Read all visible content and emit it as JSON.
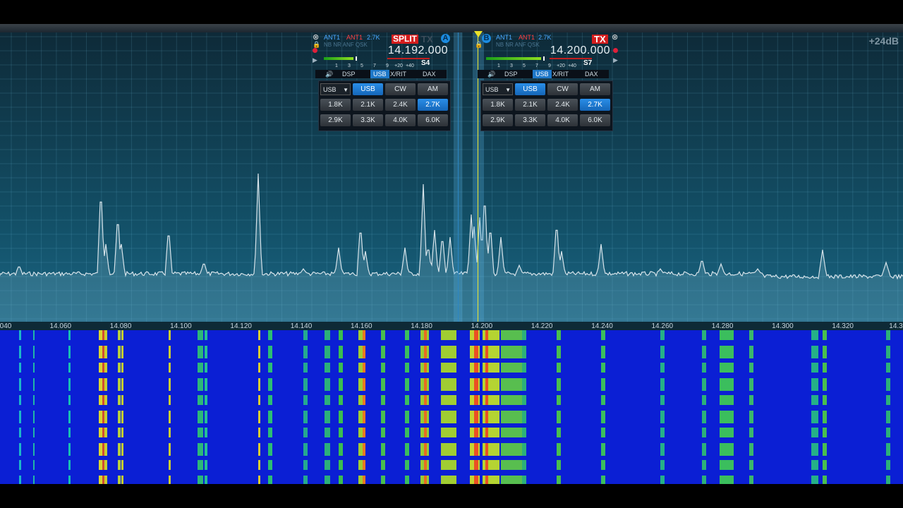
{
  "panadapter": {
    "db_label": "+24dB"
  },
  "frequency_scale": {
    "ticks": [
      "040",
      "14.060",
      "14.080",
      "14.100",
      "14.120",
      "14.140",
      "14.160",
      "14.180",
      "14.200",
      "14.220",
      "14.240",
      "14.260",
      "14.280",
      "14.300",
      "14.320",
      "14.3"
    ]
  },
  "slice_a": {
    "letter": "A",
    "rx_antenna": "ANT1",
    "tx_antenna": "ANT1",
    "filter_width": "2.7K",
    "dsp_flags": "NB NR ANF QSK",
    "split_label": "SPLIT",
    "tx_label": "TX",
    "frequency": "14.192.000",
    "s_meter": "S4",
    "s_meter_level": 0.28,
    "scale": [
      "1",
      "3",
      "5",
      "7",
      "9",
      "+20",
      "+40"
    ],
    "tabs": [
      "DSP",
      "USB",
      "X/RIT",
      "DAX"
    ],
    "active_tab": "USB",
    "mode_dropdown": "USB",
    "modes": [
      "USB",
      "CW",
      "AM"
    ],
    "active_mode": "USB",
    "filters": [
      "1.8K",
      "2.1K",
      "2.4K",
      "2.7K",
      "2.9K",
      "3.3K",
      "4.0K",
      "6.0K"
    ],
    "active_filter": "2.7K"
  },
  "slice_b": {
    "letter": "B",
    "rx_antenna": "ANT1",
    "tx_antenna": "ANT1",
    "filter_width": "2.7K",
    "dsp_flags": "NB NR ANF QSK",
    "tx_label": "TX",
    "frequency": "14.200.000",
    "s_meter": "S7",
    "s_meter_level": 0.52,
    "scale": [
      "1",
      "3",
      "5",
      "7",
      "9",
      "+20",
      "+40"
    ],
    "tabs": [
      "DSP",
      "USB",
      "X/RIT",
      "DAX"
    ],
    "active_tab": "USB",
    "mode_dropdown": "USB",
    "modes": [
      "USB",
      "CW",
      "AM"
    ],
    "active_mode": "USB",
    "filters": [
      "1.8K",
      "2.1K",
      "2.4K",
      "2.7K",
      "2.9K",
      "3.3K",
      "4.0K",
      "6.0K"
    ],
    "active_filter": "2.7K"
  },
  "colors": {
    "slice_a_line": "#2b86c4",
    "slice_b_line": "#e9e22a",
    "spectrum_trace": "#d6e3ea"
  }
}
